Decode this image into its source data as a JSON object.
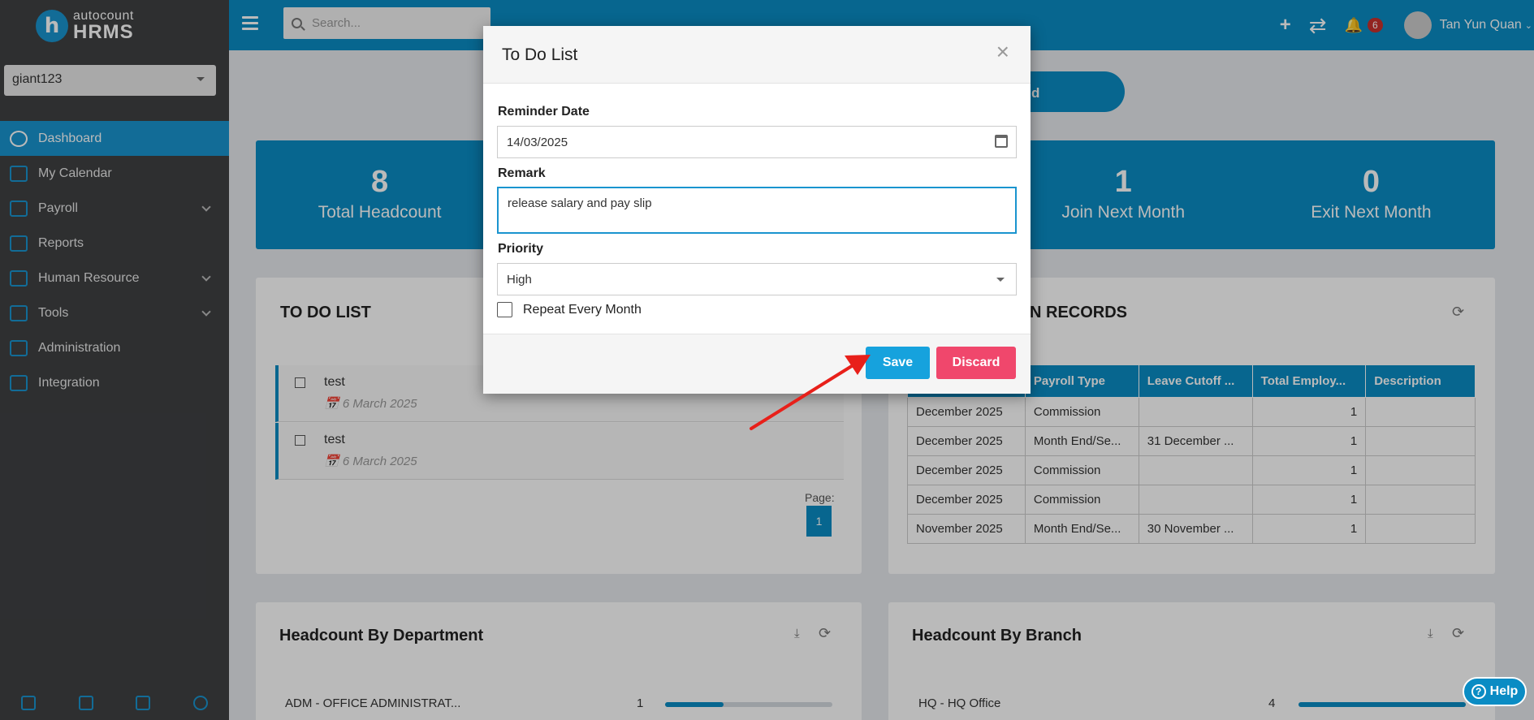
{
  "brand": {
    "top": "autocount",
    "bottom": "HRMS",
    "letter": "h"
  },
  "company": {
    "selected": "giant123"
  },
  "sidebar": {
    "items": [
      {
        "label": "Dashboard",
        "icon": "gauge-icon"
      },
      {
        "label": "My Calendar",
        "icon": "calendar-icon"
      },
      {
        "label": "Payroll",
        "icon": "payroll-icon"
      },
      {
        "label": "Reports",
        "icon": "reports-icon"
      },
      {
        "label": "Human Resource",
        "icon": "people-icon"
      },
      {
        "label": "Tools",
        "icon": "tools-icon"
      },
      {
        "label": "Administration",
        "icon": "admin-icon"
      },
      {
        "label": "Integration",
        "icon": "integration-icon"
      }
    ]
  },
  "topbar": {
    "search_placeholder": "Search...",
    "notifications": "6",
    "user": "Tan Yun Quan"
  },
  "dashboard": {
    "pill_label": "d",
    "stats": [
      {
        "num": "8",
        "label": "Total Headcount"
      },
      {
        "num": "",
        "label": ""
      },
      {
        "num": "",
        "label": ""
      },
      {
        "num": "1",
        "label": "Join Next Month"
      },
      {
        "num": "0",
        "label": "Exit Next Month"
      }
    ],
    "todo": {
      "title": "TO DO LIST",
      "items": [
        {
          "text": "test",
          "date": "6 March 2025"
        },
        {
          "text": "test",
          "date": "6 March 2025"
        }
      ],
      "page_label": "Page:",
      "page": "1"
    },
    "records": {
      "title": "N RECORDS",
      "headers": [
        "",
        "Payroll Type",
        "Leave Cutoff ...",
        "Total Employ...",
        "Description"
      ],
      "rows": [
        [
          "December 2025",
          "Commission",
          "",
          "1",
          ""
        ],
        [
          "December 2025",
          "Month End/Se...",
          "31 December ...",
          "1",
          ""
        ],
        [
          "December 2025",
          "Commission",
          "",
          "1",
          ""
        ],
        [
          "December 2025",
          "Commission",
          "",
          "1",
          ""
        ],
        [
          "November 2025",
          "Month End/Se...",
          "30 November ...",
          "1",
          ""
        ]
      ]
    },
    "dept": {
      "title": "Headcount By Department",
      "row_label": "ADM - OFFICE ADMINISTRAT...",
      "row_value": "1",
      "fill": 0.35
    },
    "branch": {
      "title": "Headcount By Branch",
      "row_label": "HQ - HQ Office",
      "row_value": "4",
      "fill": 1.0
    }
  },
  "help_label": "Help",
  "modal": {
    "title": "To Do List",
    "reminder_label": "Reminder Date",
    "reminder_value": "14/03/2025",
    "remark_label": "Remark",
    "remark_value": "release salary and pay slip",
    "priority_label": "Priority",
    "priority_value": "High",
    "repeat_label": "Repeat Every Month",
    "save_label": "Save",
    "discard_label": "Discard"
  },
  "colors": {
    "primary": "#0a8cc4",
    "discard": "#f0476c",
    "annotation": "#e8201a"
  }
}
